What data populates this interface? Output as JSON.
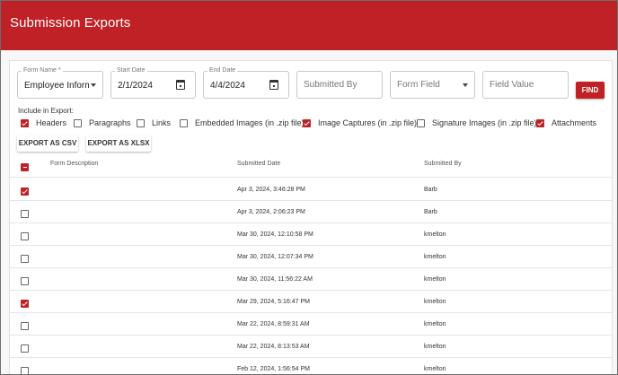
{
  "header": {
    "title": "Submission Exports"
  },
  "filters": {
    "form_name": {
      "label": "Form Name *",
      "value": "Employee Inform..."
    },
    "start_date": {
      "label": "Start Date",
      "value": "2/1/2024"
    },
    "end_date": {
      "label": "End Date",
      "value": "4/4/2024"
    },
    "submitted_by": {
      "placeholder": "Submitted By"
    },
    "form_field": {
      "placeholder": "Form Field"
    },
    "field_value": {
      "placeholder": "Field Value"
    },
    "find_label": "FIND"
  },
  "include": {
    "label": "Include in Export:",
    "options": [
      {
        "label": "Headers",
        "checked": true
      },
      {
        "label": "Paragraphs",
        "checked": false
      },
      {
        "label": "Links",
        "checked": false
      },
      {
        "label": "Embedded Images (in .zip file)",
        "checked": false
      },
      {
        "label": "Image Captures (in .zip file)",
        "checked": true
      },
      {
        "label": "Signature Images (in .zip file)",
        "checked": false
      },
      {
        "label": "Attachments",
        "checked": true
      }
    ]
  },
  "actions": {
    "export_csv": "EXPORT AS CSV",
    "export_xlsx": "EXPORT AS XLSX"
  },
  "table": {
    "columns": [
      "Form Description",
      "Submitted Date",
      "Submitted By"
    ],
    "rows": [
      {
        "checked": true,
        "description": "",
        "date": "Apr 3, 2024, 3:46:28 PM",
        "by": "Barb"
      },
      {
        "checked": false,
        "description": "",
        "date": "Apr 3, 2024, 2:06:23 PM",
        "by": "Barb"
      },
      {
        "checked": false,
        "description": "",
        "date": "Mar 30, 2024, 12:10:58 PM",
        "by": "kmelton"
      },
      {
        "checked": false,
        "description": "",
        "date": "Mar 30, 2024, 12:07:34 PM",
        "by": "kmelton"
      },
      {
        "checked": false,
        "description": "",
        "date": "Mar 30, 2024, 11:56:22 AM",
        "by": "kmelton"
      },
      {
        "checked": true,
        "description": "",
        "date": "Mar 29, 2024, 5:16:47 PM",
        "by": "kmelton"
      },
      {
        "checked": false,
        "description": "",
        "date": "Mar 22, 2024, 8:59:31 AM",
        "by": "kmelton"
      },
      {
        "checked": false,
        "description": "",
        "date": "Mar 22, 2024, 8:13:53 AM",
        "by": "kmelton"
      },
      {
        "checked": false,
        "description": "",
        "date": "Feb 12, 2024, 1:56:54 PM",
        "by": "kmelton"
      }
    ]
  },
  "colors": {
    "accent": "#c02126"
  }
}
